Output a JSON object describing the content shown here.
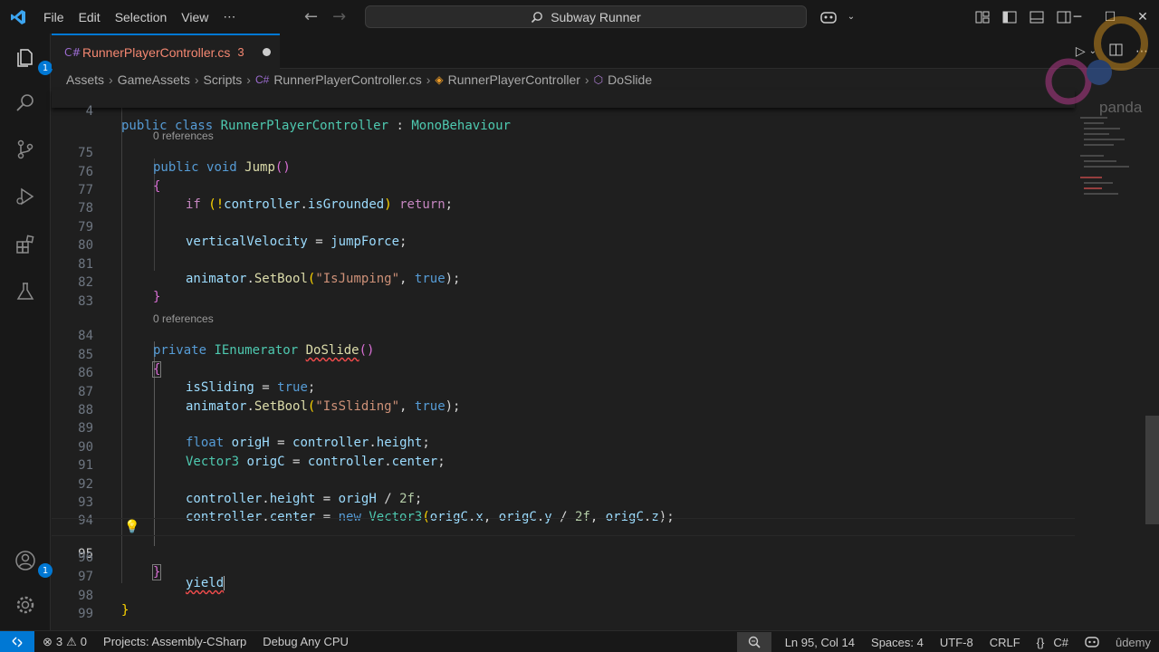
{
  "titlebar": {
    "menu": [
      "File",
      "Edit",
      "Selection",
      "View",
      "⋯"
    ],
    "search_text": "Subway Runner"
  },
  "activity_badges": {
    "explorer": "1",
    "accounts": "1"
  },
  "tab": {
    "name": "RunnerPlayerController.cs",
    "problems": "3"
  },
  "breadcrumb": [
    "Assets",
    "GameAssets",
    "Scripts",
    "RunnerPlayerController.cs",
    "RunnerPlayerController",
    "DoSlide"
  ],
  "lens": {
    "jump_refs": "0 references",
    "doslide_refs": "0 references"
  },
  "line_numbers": [
    "4",
    "75",
    "76",
    "77",
    "78",
    "79",
    "80",
    "81",
    "82",
    "83",
    "84",
    "85",
    "86",
    "87",
    "88",
    "89",
    "90",
    "91",
    "92",
    "93",
    "94",
    "95",
    "96",
    "97",
    "98",
    "99"
  ],
  "code": {
    "l4": [
      "public",
      "class",
      "RunnerPlayerController",
      ":",
      "MonoBehaviour"
    ],
    "l75": [
      "public",
      "void",
      "Jump",
      "()"
    ],
    "l76": "{",
    "l77": [
      "if",
      "(!",
      "controller",
      ".",
      "isGrounded",
      ")",
      "return",
      ";"
    ],
    "l79": [
      "verticalVelocity",
      " = ",
      "jumpForce",
      ";"
    ],
    "l81": [
      "animator",
      ".",
      "SetBool",
      "(",
      "\"IsJumping\"",
      ", ",
      "true",
      ");"
    ],
    "l82": "}",
    "l84": [
      "private",
      "IEnumerator",
      "DoSlide",
      "()"
    ],
    "l85": "{",
    "l86": [
      "isSliding",
      " = ",
      "true",
      ";"
    ],
    "l87": [
      "animator",
      ".",
      "SetBool",
      "(",
      "\"IsSliding\"",
      ", ",
      "true",
      ");"
    ],
    "l89": [
      "float",
      "origH",
      " = ",
      "controller",
      ".",
      "height",
      ";"
    ],
    "l90": [
      "Vector3",
      "origC",
      " = ",
      "controller",
      ".",
      "center",
      ";"
    ],
    "l92": [
      "controller",
      ".",
      "height",
      " = ",
      "origH",
      " / ",
      "2f",
      ";"
    ],
    "l93": [
      "controller",
      ".",
      "center",
      " = ",
      "new",
      "Vector3",
      "(",
      "origC",
      ".",
      "x",
      ", ",
      "origC",
      ".",
      "y",
      " / ",
      "2f",
      ", ",
      "origC",
      ".",
      "z",
      ");"
    ],
    "l95": "yield",
    "l96": "}",
    "l98": "}"
  },
  "statusbar": {
    "errors": "3",
    "warnings": "0",
    "project": "Projects: Assembly-CSharp",
    "debug": "Debug Any CPU",
    "position": "Ln 95, Col 14",
    "spaces": "Spaces: 4",
    "encoding": "UTF-8",
    "eol": "CRLF",
    "language_braces": "{}",
    "language": "C#"
  },
  "watermark": {
    "text": "panda",
    "udemy": "ûdemy"
  },
  "colors": {
    "accent": "#0078d4",
    "keyword": "#569cd6",
    "type": "#4ec9b0",
    "function": "#dcdcaa",
    "string": "#ce9178",
    "error": "#f14c4c"
  }
}
